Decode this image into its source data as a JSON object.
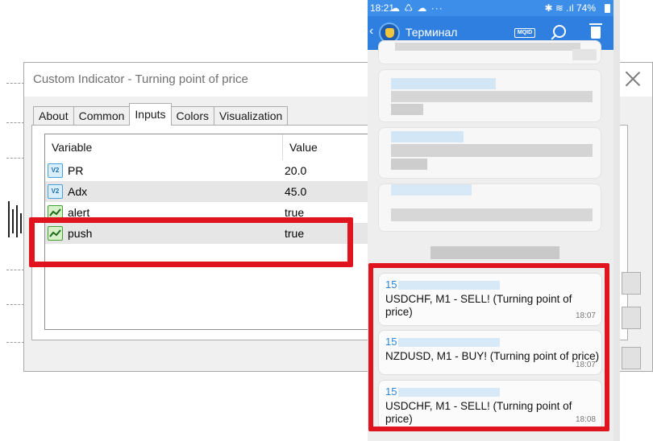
{
  "dialog": {
    "title": "Custom Indicator - Turning point of price",
    "tabs": [
      {
        "label": "About",
        "active": false
      },
      {
        "label": "Common",
        "active": false
      },
      {
        "label": "Inputs",
        "active": true
      },
      {
        "label": "Colors",
        "active": false
      },
      {
        "label": "Visualization",
        "active": false
      }
    ],
    "inputs_table": {
      "columns": [
        "Variable",
        "Value"
      ],
      "rows": [
        {
          "icon": "v2-number-icon",
          "variable": "PR",
          "value": "20.0"
        },
        {
          "icon": "v2-number-icon",
          "variable": "Adx",
          "value": "45.0"
        },
        {
          "icon": "bool-chart-icon",
          "variable": "alert",
          "value": "true"
        },
        {
          "icon": "bool-chart-icon",
          "variable": "push",
          "value": "true"
        }
      ]
    }
  },
  "phone": {
    "status_bar": {
      "time": "18:21",
      "left_icons": "☁ ♺ ☁ ···",
      "right_icons": "✱ ≋ .ıl 74%"
    },
    "app_bar": {
      "back": "‹",
      "title": "Терминал",
      "mqid_label": "MQID"
    },
    "cut_off_text": "NZDUSD, M1 - BUY! (Turning point of price)",
    "messages": [
      {
        "sender": "15",
        "text": "USDCHF, M1 - SELL! (Turning point of price)",
        "time": "18:07"
      },
      {
        "sender": "15",
        "text": "NZDUSD, M1 - BUY! (Turning point of price)",
        "time": "18:07"
      },
      {
        "sender": "15",
        "text": "USDCHF, M1 - SELL! (Turning point of price)",
        "time": "18:08"
      }
    ]
  },
  "colors": {
    "highlight": "#e0141e",
    "app_bar": "#2f7fe0",
    "sender": "#2b86d8"
  }
}
